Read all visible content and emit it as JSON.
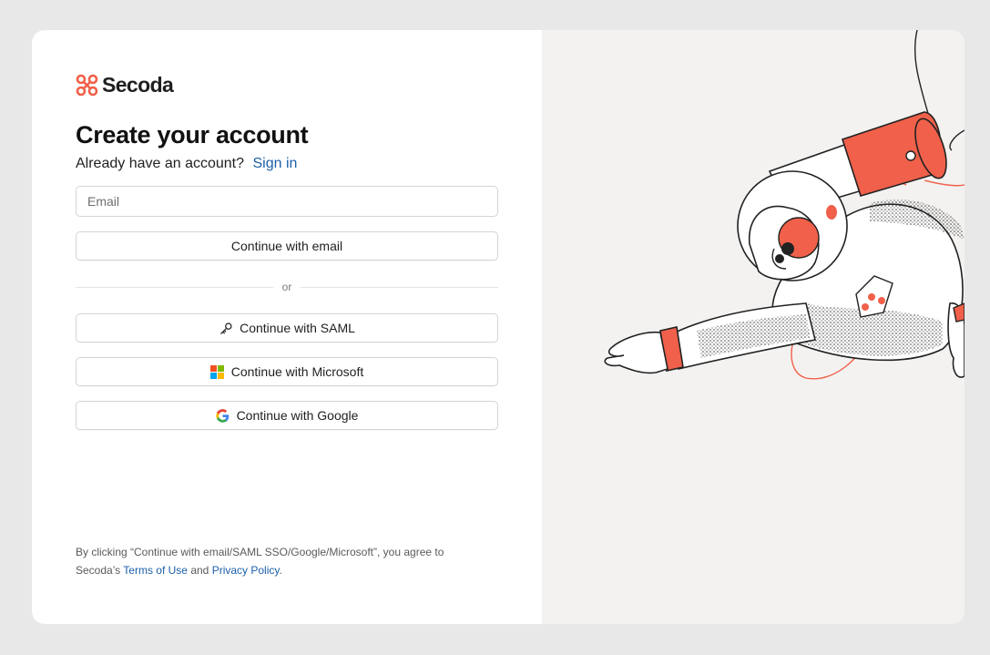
{
  "brand": {
    "name": "Secoda",
    "accent": "#f0604a"
  },
  "form": {
    "title": "Create your account",
    "signin_prompt": "Already have an account?",
    "signin_link": "Sign in",
    "email_placeholder": "Email",
    "continue_email": "Continue with email",
    "divider": "or",
    "continue_saml": "Continue with SAML",
    "continue_microsoft": "Continue with Microsoft",
    "continue_google": "Continue with Google"
  },
  "legal": {
    "prefix": "By clicking “Continue with email/SAML SSO/Google/Microsoft”, you agree to Secoda’s",
    "terms": "Terms of Use",
    "and": "and",
    "privacy": "Privacy Policy",
    "suffix": "."
  },
  "icons": {
    "saml": "key-icon",
    "microsoft": "microsoft-logo-icon",
    "google": "google-logo-icon"
  },
  "colors": {
    "link": "#1b5fa8",
    "panel": "#f3f2f0",
    "microsoft": [
      "#f25022",
      "#7fba00",
      "#00a4ef",
      "#ffb900"
    ],
    "google": [
      "#4285f4",
      "#34a853",
      "#fbbc05",
      "#ea4335"
    ]
  }
}
